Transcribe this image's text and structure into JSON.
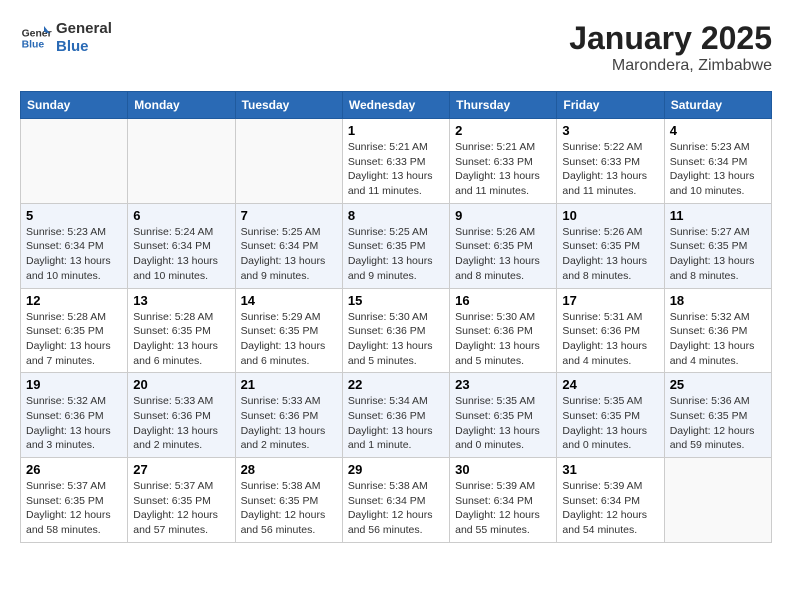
{
  "logo": {
    "line1": "General",
    "line2": "Blue"
  },
  "title": "January 2025",
  "subtitle": "Marondera, Zimbabwe",
  "days_of_week": [
    "Sunday",
    "Monday",
    "Tuesday",
    "Wednesday",
    "Thursday",
    "Friday",
    "Saturday"
  ],
  "weeks": [
    [
      {
        "day": "",
        "info": ""
      },
      {
        "day": "",
        "info": ""
      },
      {
        "day": "",
        "info": ""
      },
      {
        "day": "1",
        "info": "Sunrise: 5:21 AM\nSunset: 6:33 PM\nDaylight: 13 hours and 11 minutes."
      },
      {
        "day": "2",
        "info": "Sunrise: 5:21 AM\nSunset: 6:33 PM\nDaylight: 13 hours and 11 minutes."
      },
      {
        "day": "3",
        "info": "Sunrise: 5:22 AM\nSunset: 6:33 PM\nDaylight: 13 hours and 11 minutes."
      },
      {
        "day": "4",
        "info": "Sunrise: 5:23 AM\nSunset: 6:34 PM\nDaylight: 13 hours and 10 minutes."
      }
    ],
    [
      {
        "day": "5",
        "info": "Sunrise: 5:23 AM\nSunset: 6:34 PM\nDaylight: 13 hours and 10 minutes."
      },
      {
        "day": "6",
        "info": "Sunrise: 5:24 AM\nSunset: 6:34 PM\nDaylight: 13 hours and 10 minutes."
      },
      {
        "day": "7",
        "info": "Sunrise: 5:25 AM\nSunset: 6:34 PM\nDaylight: 13 hours and 9 minutes."
      },
      {
        "day": "8",
        "info": "Sunrise: 5:25 AM\nSunset: 6:35 PM\nDaylight: 13 hours and 9 minutes."
      },
      {
        "day": "9",
        "info": "Sunrise: 5:26 AM\nSunset: 6:35 PM\nDaylight: 13 hours and 8 minutes."
      },
      {
        "day": "10",
        "info": "Sunrise: 5:26 AM\nSunset: 6:35 PM\nDaylight: 13 hours and 8 minutes."
      },
      {
        "day": "11",
        "info": "Sunrise: 5:27 AM\nSunset: 6:35 PM\nDaylight: 13 hours and 8 minutes."
      }
    ],
    [
      {
        "day": "12",
        "info": "Sunrise: 5:28 AM\nSunset: 6:35 PM\nDaylight: 13 hours and 7 minutes."
      },
      {
        "day": "13",
        "info": "Sunrise: 5:28 AM\nSunset: 6:35 PM\nDaylight: 13 hours and 6 minutes."
      },
      {
        "day": "14",
        "info": "Sunrise: 5:29 AM\nSunset: 6:35 PM\nDaylight: 13 hours and 6 minutes."
      },
      {
        "day": "15",
        "info": "Sunrise: 5:30 AM\nSunset: 6:36 PM\nDaylight: 13 hours and 5 minutes."
      },
      {
        "day": "16",
        "info": "Sunrise: 5:30 AM\nSunset: 6:36 PM\nDaylight: 13 hours and 5 minutes."
      },
      {
        "day": "17",
        "info": "Sunrise: 5:31 AM\nSunset: 6:36 PM\nDaylight: 13 hours and 4 minutes."
      },
      {
        "day": "18",
        "info": "Sunrise: 5:32 AM\nSunset: 6:36 PM\nDaylight: 13 hours and 4 minutes."
      }
    ],
    [
      {
        "day": "19",
        "info": "Sunrise: 5:32 AM\nSunset: 6:36 PM\nDaylight: 13 hours and 3 minutes."
      },
      {
        "day": "20",
        "info": "Sunrise: 5:33 AM\nSunset: 6:36 PM\nDaylight: 13 hours and 2 minutes."
      },
      {
        "day": "21",
        "info": "Sunrise: 5:33 AM\nSunset: 6:36 PM\nDaylight: 13 hours and 2 minutes."
      },
      {
        "day": "22",
        "info": "Sunrise: 5:34 AM\nSunset: 6:36 PM\nDaylight: 13 hours and 1 minute."
      },
      {
        "day": "23",
        "info": "Sunrise: 5:35 AM\nSunset: 6:35 PM\nDaylight: 13 hours and 0 minutes."
      },
      {
        "day": "24",
        "info": "Sunrise: 5:35 AM\nSunset: 6:35 PM\nDaylight: 13 hours and 0 minutes."
      },
      {
        "day": "25",
        "info": "Sunrise: 5:36 AM\nSunset: 6:35 PM\nDaylight: 12 hours and 59 minutes."
      }
    ],
    [
      {
        "day": "26",
        "info": "Sunrise: 5:37 AM\nSunset: 6:35 PM\nDaylight: 12 hours and 58 minutes."
      },
      {
        "day": "27",
        "info": "Sunrise: 5:37 AM\nSunset: 6:35 PM\nDaylight: 12 hours and 57 minutes."
      },
      {
        "day": "28",
        "info": "Sunrise: 5:38 AM\nSunset: 6:35 PM\nDaylight: 12 hours and 56 minutes."
      },
      {
        "day": "29",
        "info": "Sunrise: 5:38 AM\nSunset: 6:34 PM\nDaylight: 12 hours and 56 minutes."
      },
      {
        "day": "30",
        "info": "Sunrise: 5:39 AM\nSunset: 6:34 PM\nDaylight: 12 hours and 55 minutes."
      },
      {
        "day": "31",
        "info": "Sunrise: 5:39 AM\nSunset: 6:34 PM\nDaylight: 12 hours and 54 minutes."
      },
      {
        "day": "",
        "info": ""
      }
    ]
  ]
}
